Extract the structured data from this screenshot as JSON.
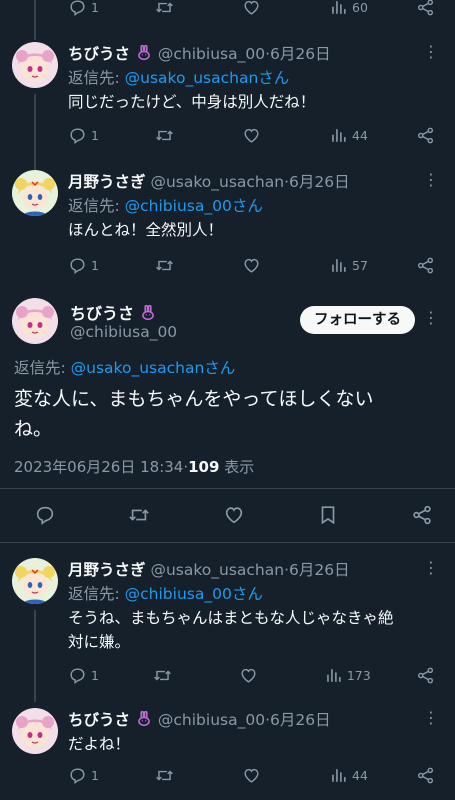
{
  "top_actions": {
    "replies": "1",
    "retweets": "",
    "likes": "",
    "views": "60"
  },
  "reply_prefix": "返信先: ",
  "tweets_above": [
    {
      "name": "ちびうさ",
      "handle": "@chibiusa_00",
      "date": "6月26日",
      "reply_to": "@usako_usachanさん",
      "text": "同じだったけど、中身は別人だね！",
      "replies": "1",
      "retweets": "",
      "likes": "",
      "views": "44"
    },
    {
      "name": "月野うさぎ",
      "handle": "@usako_usachan",
      "date": "6月26日",
      "reply_to": "@chibiusa_00さん",
      "text": "ほんとね！全然別人！",
      "replies": "1",
      "retweets": "",
      "likes": "",
      "views": "57"
    }
  ],
  "main_tweet": {
    "name": "ちびうさ",
    "handle": "@chibiusa_00",
    "follow_label": "フォローする",
    "reply_prefix": "返信先: ",
    "reply_to": "@usako_usachanさん",
    "text_line1": "変な人に、まもちゃんをやってほしくない",
    "text_line2": "ね。",
    "timestamp": "2023年06月26日 18:34",
    "views_count": "109",
    "views_label": "表示"
  },
  "tweets_below": [
    {
      "name": "月野うさぎ",
      "handle": "@usako_usachan",
      "date": "6月26日",
      "reply_to": "@chibiusa_00さん",
      "text_line1": "そうね、まもちゃんはまともな人じゃなきゃ絶",
      "text_line2": "対に嫌。",
      "replies": "1",
      "retweets": "",
      "likes": "",
      "views": "173"
    },
    {
      "name": "ちびうさ",
      "handle": "@chibiusa_00",
      "date": "6月26日",
      "text": "だよね！",
      "replies": "1",
      "retweets": "",
      "likes": "",
      "views": "44"
    }
  ],
  "separator": "·",
  "colors": {
    "background": "#15202b",
    "link": "#1d9bf0",
    "muted": "#8b98a5",
    "bunny": "#c06ad9"
  }
}
